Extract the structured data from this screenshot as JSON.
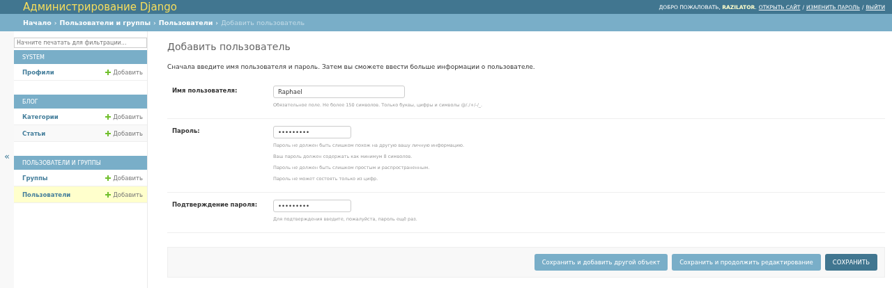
{
  "header": {
    "title": "Администрирование Django",
    "welcome": "ДОБРО ПОЖАЛОВАТЬ, **RAZILATOR**.",
    "separator": "/",
    "links": [
      "ОТКРЫТЬ САЙТ",
      "ИЗМЕНИТЬ ПАРОЛЬ",
      "ВЫЙТИ"
    ]
  },
  "breadcrumbs": {
    "separator": "›",
    "links": [
      "Начало",
      "Пользователи и группы",
      "Пользователи"
    ],
    "current": "Добавить пользователь"
  },
  "sidebar": {
    "filter_placeholder": "Начните печатать для фильтрации...",
    "collapse": "«",
    "modules": [
      {
        "title": "SYSTEM",
        "items": [
          {
            "name": "Профили",
            "add": "Добавить",
            "selected": false
          }
        ]
      },
      {
        "title": "БЛОГ",
        "items": [
          {
            "name": "Категории",
            "add": "Добавить",
            "selected": false
          },
          {
            "name": "Статьи",
            "add": "Добавить",
            "selected": false
          }
        ]
      },
      {
        "title": "ПОЛЬЗОВАТЕЛИ И ГРУППЫ",
        "items": [
          {
            "name": "Группы",
            "add": "Добавить",
            "selected": false
          },
          {
            "name": "Пользователи",
            "add": "Добавить",
            "selected": true
          }
        ]
      }
    ]
  },
  "content": {
    "title": "Добавить пользователь",
    "intro": "Сначала введите имя пользователя и пароль. Затем вы сможете ввести больше информации о пользователе.",
    "fields": [
      {
        "label": "Имя пользователя:",
        "value": "Raphael",
        "kind": "wide",
        "help": [
          "Обязательное поле. Не более 150 символов. Только буквы, цифры и символы @/./+/-/_."
        ]
      },
      {
        "label": "Пароль:",
        "value": "•••••••••",
        "kind": "narrow",
        "help": [
          "Пароль не должен быть слишком похож на другую вашу личную информацию.",
          "Ваш пароль должен содержать как минимум 8 символов.",
          "Пароль не должен быть слишком простым и распространенным.",
          "Пароль не может состоять только из цифр."
        ]
      },
      {
        "label": "Подтверждение пароля:",
        "value": "•••••••••",
        "kind": "narrow",
        "help": [
          "Для подтверждения введите, пожалуйста, пароль ещё раз."
        ]
      }
    ],
    "buttons": [
      {
        "label": "Сохранить и добавить другой объект",
        "kind": "secondary"
      },
      {
        "label": "Сохранить и продолжить редактирование",
        "kind": "secondary"
      },
      {
        "label": "СОХРАНИТЬ",
        "kind": "primary"
      }
    ]
  }
}
